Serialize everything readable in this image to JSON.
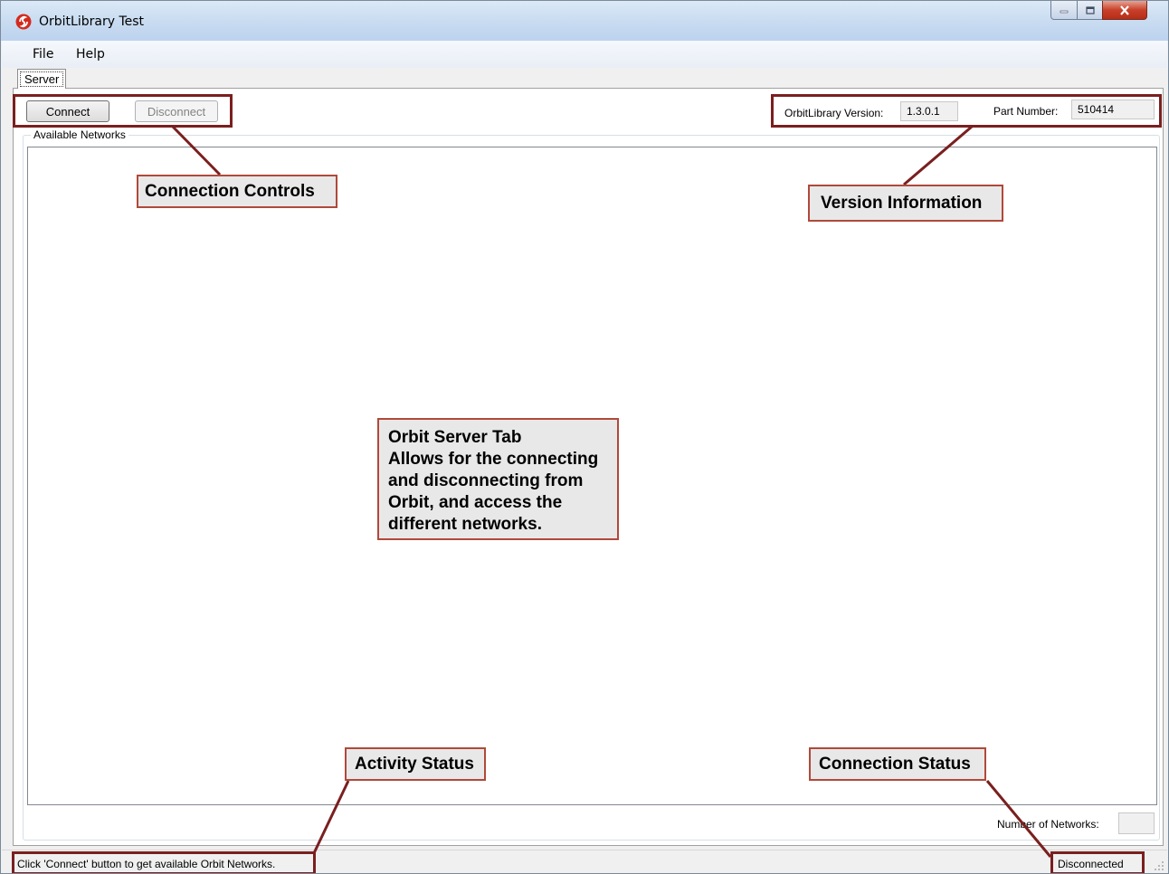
{
  "window": {
    "title": "OrbitLibrary Test"
  },
  "menu": {
    "file": "File",
    "help": "Help"
  },
  "tabs": [
    {
      "label": "Server"
    }
  ],
  "server_tab": {
    "connect_label": "Connect",
    "disconnect_label": "Disconnect",
    "version_label": "OrbitLibrary Version:",
    "version_value": "1.3.0.1",
    "part_number_label": "Part Number:",
    "part_number_value": "510414",
    "networks_group_title": "Available Networks",
    "num_networks_label": "Number of Networks:",
    "num_networks_value": ""
  },
  "status_bar": {
    "activity": "Click 'Connect' button to get available Orbit Networks.",
    "connection": "Disconnected"
  },
  "annotations": {
    "connection_controls": "Connection Controls",
    "version_information": "Version Information",
    "server_tab_title": "Orbit Server Tab",
    "server_tab_desc": "Allows for the connecting and disconnecting from Orbit, and access the different networks.",
    "activity_status": "Activity Status",
    "connection_status": "Connection Status"
  },
  "colors": {
    "annotation_frame": "#7a1f1f",
    "callout_border": "#b0493a",
    "callout_fill": "#e8e8e8"
  }
}
